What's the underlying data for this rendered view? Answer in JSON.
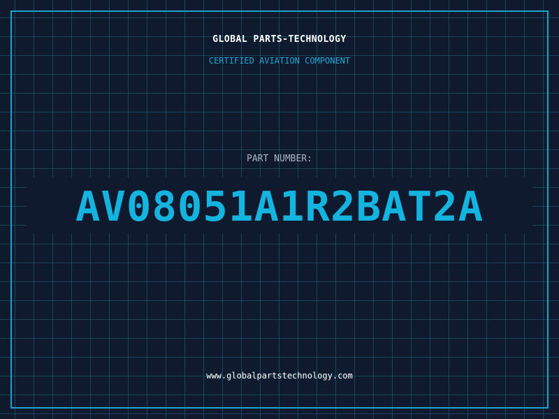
{
  "header": {
    "company_name": "GLOBAL PARTS-TECHNOLOGY",
    "tagline": "CERTIFIED AVIATION COMPONENT"
  },
  "part": {
    "label": "PART NUMBER:",
    "number": "AV08051A1R2BAT2A"
  },
  "footer": {
    "website": "www.globalpartstechnology.com"
  },
  "colors": {
    "background": "#0f1a2e",
    "grid": "#28788c",
    "frame": "#1aa3cc",
    "accent": "#14b4e0",
    "label": "#a9b4c6",
    "text": "#ffffff"
  }
}
